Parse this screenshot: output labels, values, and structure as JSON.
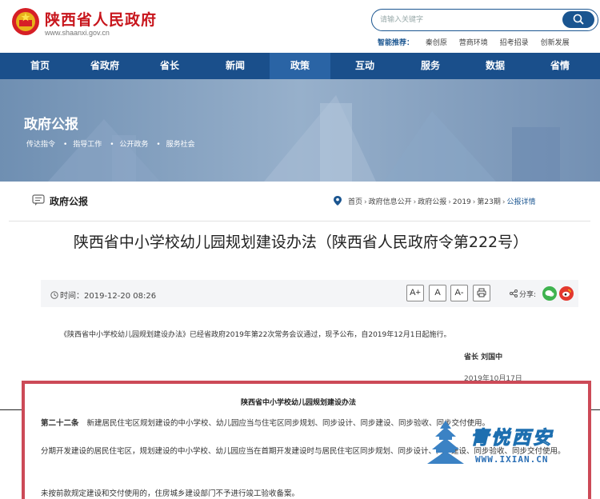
{
  "header": {
    "site_title": "陕西省人民政府",
    "site_url": "www.shaanxi.gov.cn",
    "search_placeholder": "请输入关键字",
    "smart_rec_label": "智能推荐：",
    "smart_rec_items": [
      "秦创原",
      "营商环境",
      "招考招录",
      "创新发展"
    ]
  },
  "nav": {
    "items": [
      "首页",
      "省政府",
      "省长",
      "新闻",
      "政策",
      "互动",
      "服务",
      "数据",
      "省情"
    ],
    "active": "政策"
  },
  "banner": {
    "title": "政府公报",
    "links": [
      "传达指令",
      "指导工作",
      "公开政务",
      "服务社会"
    ]
  },
  "section": {
    "title": "政府公报",
    "breadcrumb": [
      "首页",
      "政府信息公开",
      "政府公报",
      "2019",
      "第23期",
      "公报详情"
    ]
  },
  "article": {
    "title": "陕西省中小学校幼儿园规划建设办法（陕西省人民政府令第222号）",
    "time": "时间：2019-12-20 08:26",
    "font_buttons": [
      "A+",
      "A",
      "A-"
    ],
    "share_label": "分享:",
    "intro": "《陕西省中小学校幼儿园规划建设办法》已经省政府2019年第22次常务会议通过，现予公布，自2019年12月1日起施行。",
    "signature": "省长   刘国中",
    "date": "2019年10月17日"
  },
  "excerpt": {
    "title": "陕西省中小学校幼儿园规划建设办法",
    "article_no": "第二十二条",
    "p1": "新建居民住宅区规划建设的中小学校、幼儿园应当与住宅区同步规划、同步设计、同步建设、同步验收、同步交付使用。",
    "p2": "分期开发建设的居民住宅区，规划建设的中小学校、幼儿园应当在首期开发建设时与居民住宅区同步规划、同步设计、同步建设、同步验收、同步交付使用。",
    "p3": "未按前款规定建设和交付使用的，住房城乡建设部门不予进行竣工验收备案。"
  },
  "watermark": {
    "text": "青悦西安",
    "url": "WWW.IXIAN.CN"
  },
  "colors": {
    "brand_red": "#c8161d",
    "nav_blue": "#1a4f8b",
    "highlight_border": "#cc4a57"
  }
}
